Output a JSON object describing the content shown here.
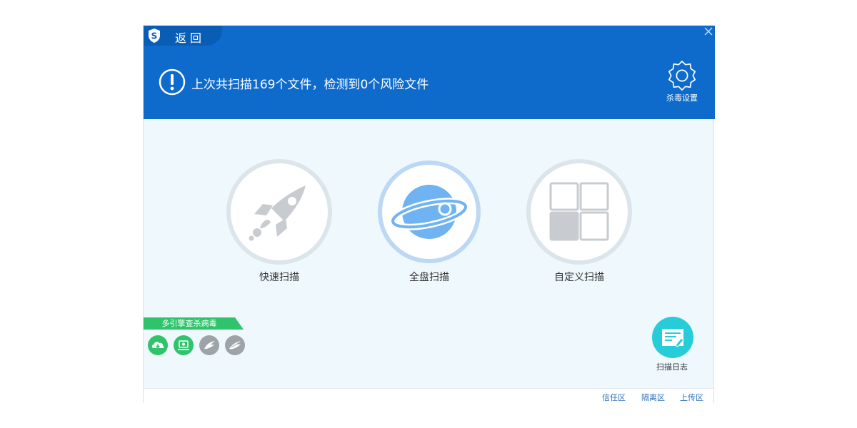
{
  "header": {
    "back_label": "返回",
    "status_text": "上次共扫描169个文件，检测到0个风险文件",
    "settings_label": "杀毒设置"
  },
  "scan_options": [
    {
      "label": "快速扫描",
      "icon": "rocket-icon"
    },
    {
      "label": "全盘扫描",
      "icon": "planet-icon"
    },
    {
      "label": "自定义扫描",
      "icon": "grid-icon"
    }
  ],
  "engines": {
    "banner_label": "多引擎查杀病毒",
    "items": [
      {
        "icon": "cloud-engine-icon",
        "active": true
      },
      {
        "icon": "local-engine-icon",
        "active": true
      },
      {
        "icon": "wing-engine-icon",
        "active": false
      },
      {
        "icon": "wing-engine-2-icon",
        "active": false
      }
    ]
  },
  "scan_log": {
    "label": "扫描日志"
  },
  "footer": {
    "trust_zone": "信任区",
    "quarantine_zone": "隔离区",
    "upload_zone": "上传区"
  },
  "colors": {
    "header_blue": "#0f6bcb",
    "content_bg": "#eff8fd",
    "engine_green": "#2fc36c",
    "engine_gray": "#9da3a7",
    "log_teal": "#26cdd8",
    "link_blue": "#2f6fb8"
  }
}
